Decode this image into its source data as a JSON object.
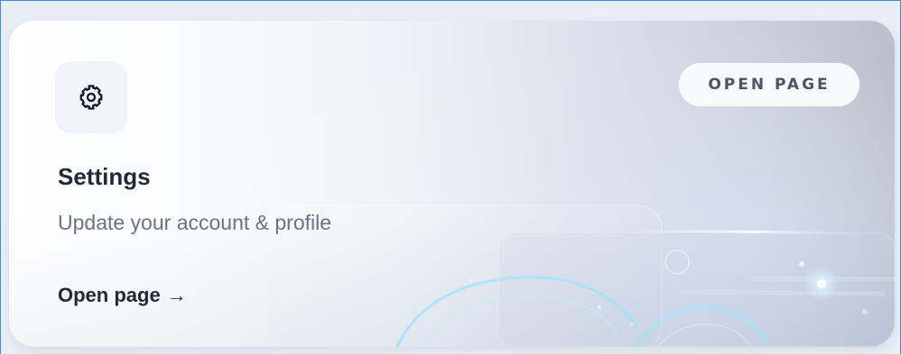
{
  "card": {
    "badge": "OPEN PAGE",
    "title": "Settings",
    "subtitle": "Update your account & profile",
    "link_label": "Open page",
    "link_arrow": "→",
    "icon": "gear-icon"
  },
  "colors": {
    "accent": "#3d8fd8",
    "title": "#1f2937",
    "subtitle": "#6b7280",
    "badge_text": "#4b5563"
  }
}
